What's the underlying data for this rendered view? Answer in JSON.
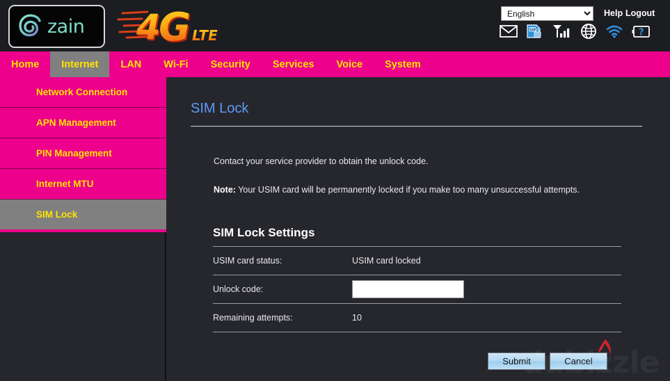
{
  "header": {
    "brand_name": "zain",
    "brand_logo_icon": "zain-swirl-logo",
    "network_logo_text": "4G",
    "network_logo_suffix": "LTE",
    "language_value": "English",
    "language_options": [
      "English"
    ],
    "help_label": "Help",
    "logout_label": "Logout",
    "status_icons": [
      {
        "name": "mail-icon",
        "title": "Messages"
      },
      {
        "name": "sim-lock-icon",
        "title": "SIM"
      },
      {
        "name": "signal-bars-icon",
        "title": "Signal"
      },
      {
        "name": "globe-icon",
        "title": "Internet"
      },
      {
        "name": "wifi-icon",
        "title": "Wi-Fi"
      },
      {
        "name": "battery-unknown-icon",
        "title": "Battery"
      }
    ]
  },
  "nav": {
    "items": [
      {
        "label": "Home",
        "active": false
      },
      {
        "label": "Internet",
        "active": true
      },
      {
        "label": "LAN",
        "active": false
      },
      {
        "label": "Wi-Fi",
        "active": false
      },
      {
        "label": "Security",
        "active": false
      },
      {
        "label": "Services",
        "active": false
      },
      {
        "label": "Voice",
        "active": false
      },
      {
        "label": "System",
        "active": false
      }
    ]
  },
  "sidebar": {
    "items": [
      {
        "label": "Network Connection",
        "active": false
      },
      {
        "label": "APN Management",
        "active": false
      },
      {
        "label": "PIN Management",
        "active": false
      },
      {
        "label": "Internet MTU",
        "active": false
      },
      {
        "label": "SIM Lock",
        "active": true
      }
    ]
  },
  "main": {
    "page_title": "SIM Lock",
    "intro_text": "Contact your service provider to obtain the unlock code.",
    "note_label": "Note:",
    "note_text": " Your USIM card will be permanently locked if you make too many unsuccessful attempts.",
    "section_title": "SIM Lock Settings",
    "rows": [
      {
        "label": "USIM card status:",
        "value": "USIM card locked",
        "type": "text"
      },
      {
        "label": "Unlock code:",
        "value": "",
        "placeholder": "",
        "type": "input"
      },
      {
        "label": "Remaining attempts:",
        "value": "10",
        "type": "text"
      }
    ],
    "submit_label": "Submit",
    "cancel_label": "Cancel"
  },
  "watermark": {
    "text": "dubizzle"
  },
  "colors": {
    "accent_pink": "#ec008c",
    "nav_text_yellow": "#ffe400",
    "active_gray": "#808080",
    "background_dark": "#26272d",
    "title_blue": "#5b9bf5",
    "icon_blue": "#2f8fd8"
  }
}
